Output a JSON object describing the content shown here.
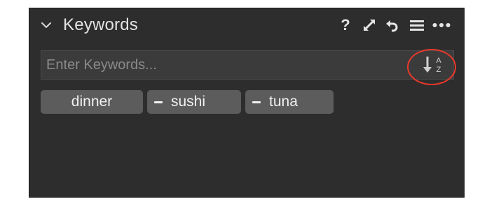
{
  "panel": {
    "title": "Keywords",
    "header_icons": {
      "help": "?",
      "expand": "expand-icon",
      "reset": "reset-icon",
      "menu": "menu-icon",
      "more": "more-icon"
    }
  },
  "search": {
    "placeholder": "Enter Keywords...",
    "value": "",
    "sort_icon": "sort-az-icon",
    "sort_letters": [
      "A",
      "Z"
    ]
  },
  "keywords": [
    {
      "label": "dinner",
      "has_minus": false
    },
    {
      "label": "sushi",
      "has_minus": true
    },
    {
      "label": "tuna",
      "has_minus": true
    }
  ],
  "colors": {
    "panel_bg": "#2d2d2d",
    "input_bg": "#3b3b3b",
    "tag_bg": "#5c5c5c",
    "text": "#e3e3e3",
    "highlight": "#e8392b"
  }
}
